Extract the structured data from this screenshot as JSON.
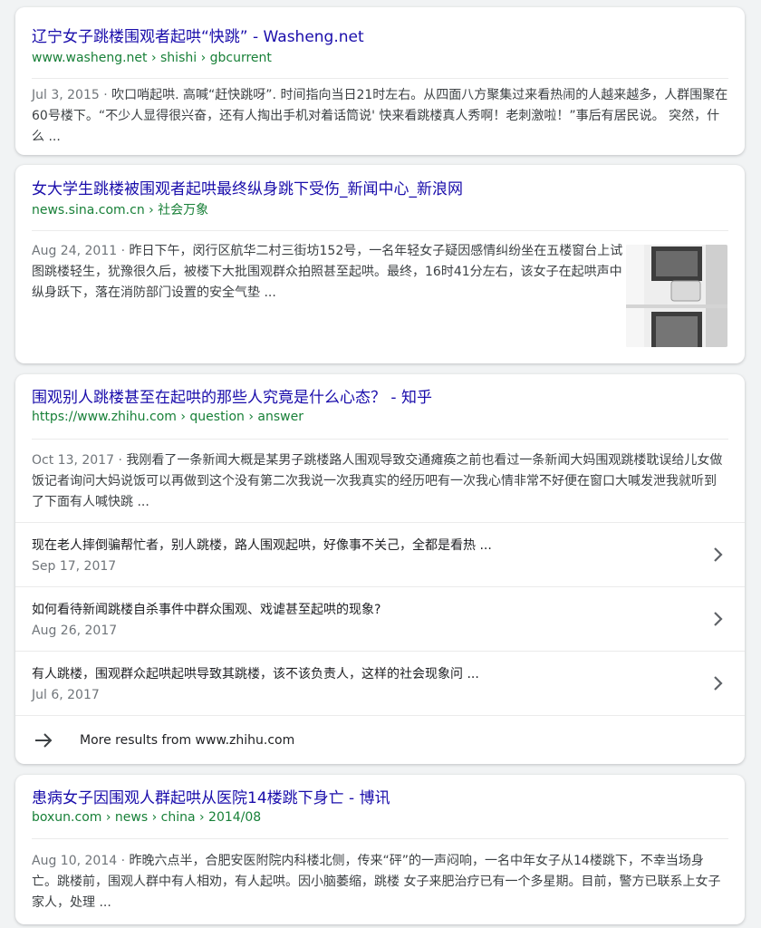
{
  "results": [
    {
      "title": "辽宁女子跳楼围观者起哄“快跳” - Washeng.net",
      "url": "www.washeng.net › shishi › gbcurrent",
      "date": "Jul 3, 2015",
      "snippet": "吹口哨起哄. 高喊“赶快跳呀”. 时间指向当日21时左右。从四面八方聚集过来看热闹的人越来越多，人群围聚在60号楼下。“不少人显得很兴奋，还有人掏出手机对着话筒说' 快来看跳楼真人秀啊！老刺激啦！”事后有居民说。 突然，什么 ..."
    },
    {
      "title": "女大学生跳楼被围观者起哄最终纵身跳下受伤_新闻中心_新浪网",
      "url": "news.sina.com.cn › 社会万象",
      "date": "Aug 24, 2011",
      "snippet": "昨日下午，闵行区航华二村三街坊152号，一名年轻女子疑因感情纠纷坐在五楼窗台上试图跳楼轻生，犹豫很久后，被楼下大批围观群众拍照甚至起哄。最终，16时41分左右，该女子在起哄声中纵身跃下，落在消防部门设置的安全气垫 ..."
    },
    {
      "title": "围观别人跳楼甚至在起哄的那些人究竟是什么心态？ - 知乎",
      "url": "https://www.zhihu.com › question › answer",
      "date": "Oct 13, 2017",
      "snippet": "我刚看了一条新闻大概是某男子跳楼路人围观导致交通瘫痪之前也看过一条新闻大妈围观跳楼耽误给儿女做饭记者询问大妈说饭可以再做到这个没有第二次我说一次我真实的经历吧有一次我心情非常不好便在窗口大喊发泄我就听到了下面有人喊快跳 ...",
      "sub_results": [
        {
          "title": "现在老人摔倒骗帮忙者，别人跳楼，路人围观起哄，好像事不关己，全都是看热 ...",
          "date": "Sep 17, 2017"
        },
        {
          "title": "如何看待新闻跳楼自杀事件中群众围观、戏谑甚至起哄的现象?",
          "date": "Aug 26, 2017"
        },
        {
          "title": "有人跳楼，围观群众起哄起哄导致其跳楼，该不该负责人，这样的社会现象问 ...",
          "date": "Jul 6, 2017"
        }
      ],
      "more_label": "More results from www.zhihu.com"
    },
    {
      "title": "患病女子因围观人群起哄从医院14楼跳下身亡 - 博讯",
      "url": "boxun.com › news › china › 2014/08",
      "date": "Aug 10, 2014",
      "snippet": "昨晚六点半，合肥安医附院内科楼北侧，传来“砰”的一声闷响，一名中年女子从14楼跳下，不幸当场身亡。跳楼前，围观人群中有人相劝，有人起哄。因小脑萎缩，跳楼 女子来肥治疗已有一个多星期。目前，警方已联系上女子家人，处理 ..."
    }
  ],
  "separator": " · "
}
